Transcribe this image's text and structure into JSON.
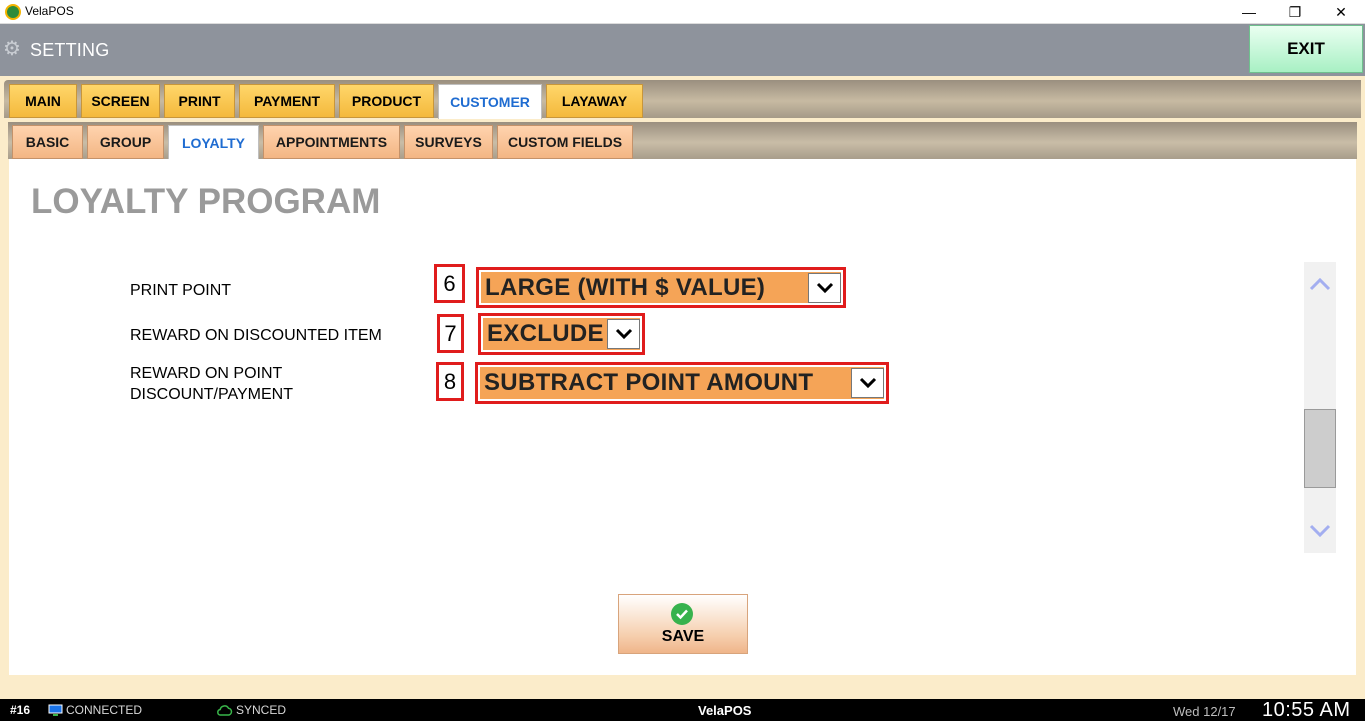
{
  "window": {
    "title": "VelaPOS",
    "min_glyph": "—",
    "max_glyph": "❐",
    "close_glyph": "✕"
  },
  "header": {
    "title": "SETTING",
    "exit_label": "EXIT"
  },
  "main_tabs": [
    {
      "label": "MAIN"
    },
    {
      "label": "SCREEN"
    },
    {
      "label": "PRINT"
    },
    {
      "label": "PAYMENT"
    },
    {
      "label": "PRODUCT"
    },
    {
      "label": "CUSTOMER",
      "active": true
    },
    {
      "label": "LAYAWAY"
    }
  ],
  "sub_tabs": [
    {
      "label": "BASIC"
    },
    {
      "label": "GROUP"
    },
    {
      "label": "LOYALTY",
      "active": true
    },
    {
      "label": "APPOINTMENTS"
    },
    {
      "label": "SURVEYS"
    },
    {
      "label": "CUSTOM FIELDS"
    }
  ],
  "page": {
    "title": "LOYALTY PROGRAM"
  },
  "settings": [
    {
      "label": "PRINT POINT",
      "marker": "6",
      "value": "LARGE (WITH $ VALUE)"
    },
    {
      "label": "REWARD ON DISCOUNTED ITEM",
      "marker": "7",
      "value": "EXCLUDE"
    },
    {
      "label_line1": "REWARD ON POINT",
      "label_line2": "DISCOUNT/PAYMENT",
      "marker": "8",
      "value": "SUBTRACT POINT AMOUNT"
    }
  ],
  "save_label": "SAVE",
  "statusbar": {
    "station": "#16",
    "connection": "CONNECTED",
    "sync": "SYNCED",
    "brand": "VelaPOS",
    "date": "Wed 12/17",
    "time": "10:55 AM"
  },
  "colors": {
    "header": "#8e939c",
    "frame": "#fbecca",
    "dropdown": "#f5a457",
    "highlight_border": "#e01c1c",
    "active_tab_text": "#1f6cd1",
    "exit_button": "#a8f0c4"
  },
  "icons": {
    "settings": "gear-icon",
    "app": "app-logo-icon",
    "save": "checkmark-icon",
    "connected": "monitor-icon",
    "synced": "cloud-icon"
  }
}
